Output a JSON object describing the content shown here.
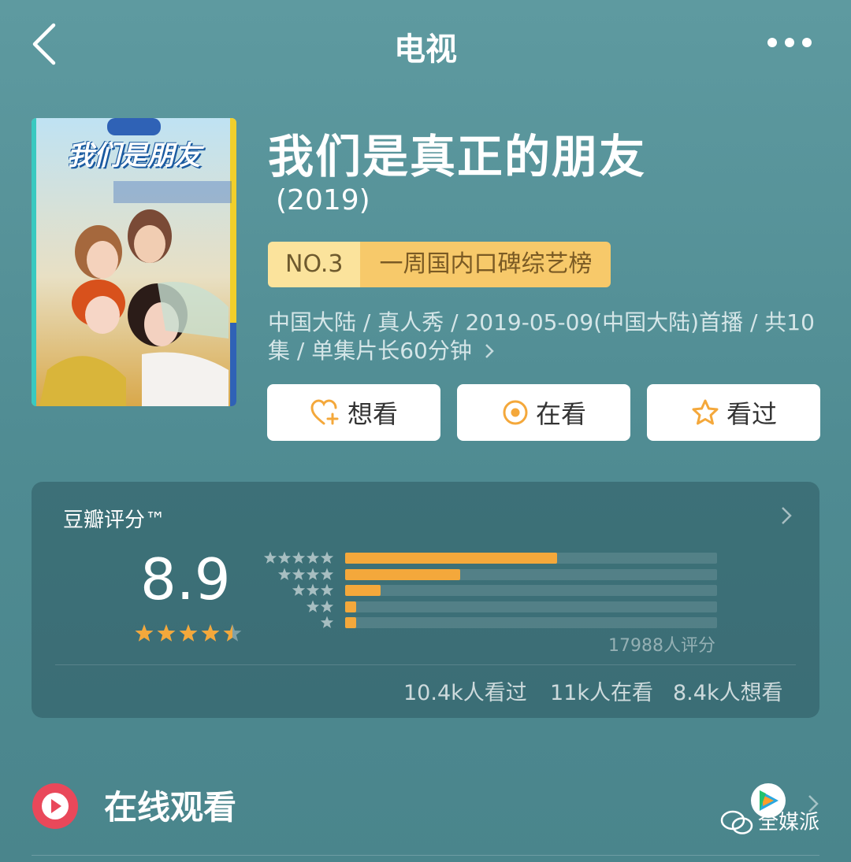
{
  "nav": {
    "title": "电视",
    "back_icon": "chevron-left-icon",
    "more_icon": "more-dots-icon"
  },
  "poster": {
    "title_text": "我们是朋友"
  },
  "show": {
    "title": "我们是真正的朋友",
    "year": "(2019)"
  },
  "rank": {
    "number": "NO.3",
    "name": "一周国内口碑综艺榜"
  },
  "meta": {
    "text": "中国大陆 / 真人秀 / 2019-05-09(中国大陆)首播 / 共10集 / 单集片长60分钟",
    "more_icon": "chevron-right-icon"
  },
  "actions": [
    {
      "label": "想看",
      "icon": "heart-plus-icon"
    },
    {
      "label": "在看",
      "icon": "target-circle-icon"
    },
    {
      "label": "看过",
      "icon": "star-outline-icon"
    }
  ],
  "rating": {
    "title": "豆瓣评分™",
    "score": "8.9",
    "stars": 4.5,
    "distribution": [
      {
        "stars": 5,
        "fraction": 0.57
      },
      {
        "stars": 4,
        "fraction": 0.31
      },
      {
        "stars": 3,
        "fraction": 0.095
      },
      {
        "stars": 2,
        "fraction": 0.03
      },
      {
        "stars": 1,
        "fraction": 0.03
      }
    ],
    "count": "17988人评分",
    "watched": "10.4k人看过",
    "watching": "11k人在看",
    "want": "8.4k人想看",
    "colors": {
      "bar": "#f4a83b",
      "star": "#f4a83b"
    }
  },
  "watch": {
    "label": "在线观看",
    "play_icon": "play-icon"
  },
  "watermark": {
    "text": "全媒派"
  }
}
